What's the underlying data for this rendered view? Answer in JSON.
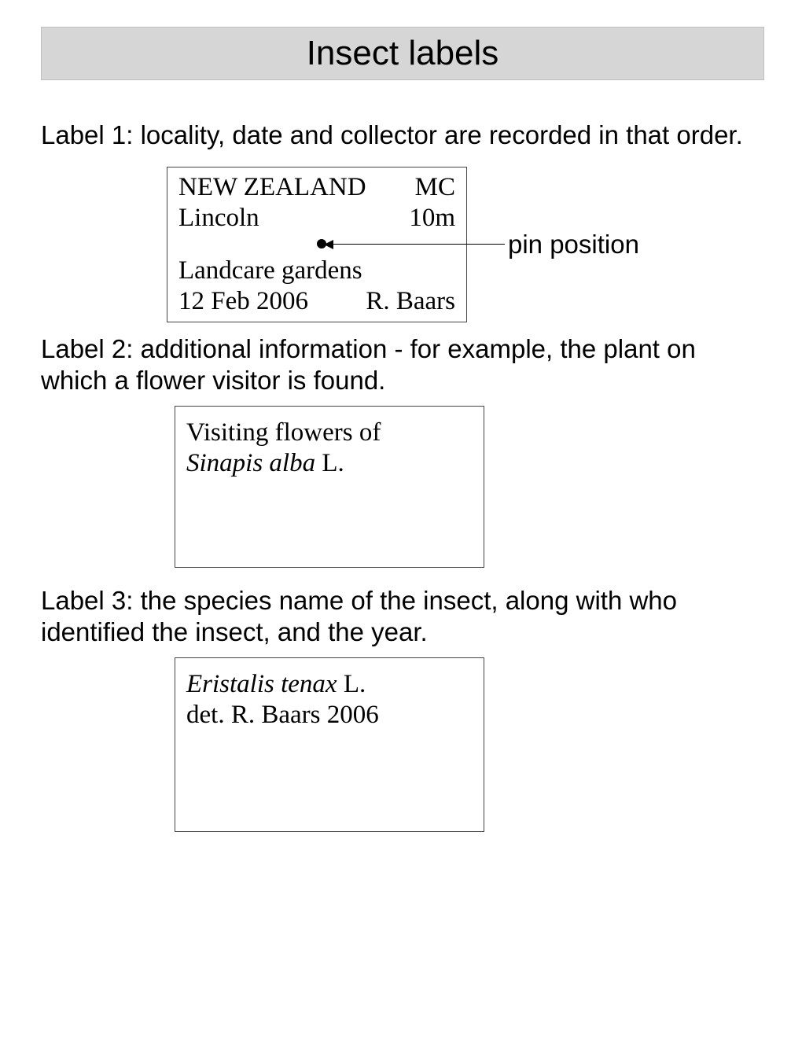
{
  "title": "Insect labels",
  "label1": {
    "desc": "Label 1: locality, date and collector are recorded in that order.",
    "row1_left": "NEW ZEALAND",
    "row1_right": "MC",
    "row2_left": "Lincoln",
    "row2_right": "10m",
    "row3": "Landcare gardens",
    "row4_left": "12 Feb 2006",
    "row4_right": "R. Baars",
    "pin_caption": "pin position"
  },
  "label2": {
    "desc": "Label 2: additional information - for example, the plant on which a flower visitor is found.",
    "line1": "Visiting flowers of",
    "line2_italic": "Sinapis alba",
    "line2_after": " L."
  },
  "label3": {
    "desc": "Label 3: the species name of the insect, along with who identified the insect, and the year.",
    "line1_italic": "Eristalis tenax",
    "line1_after": " L.",
    "line2": "det. R. Baars 2006"
  }
}
